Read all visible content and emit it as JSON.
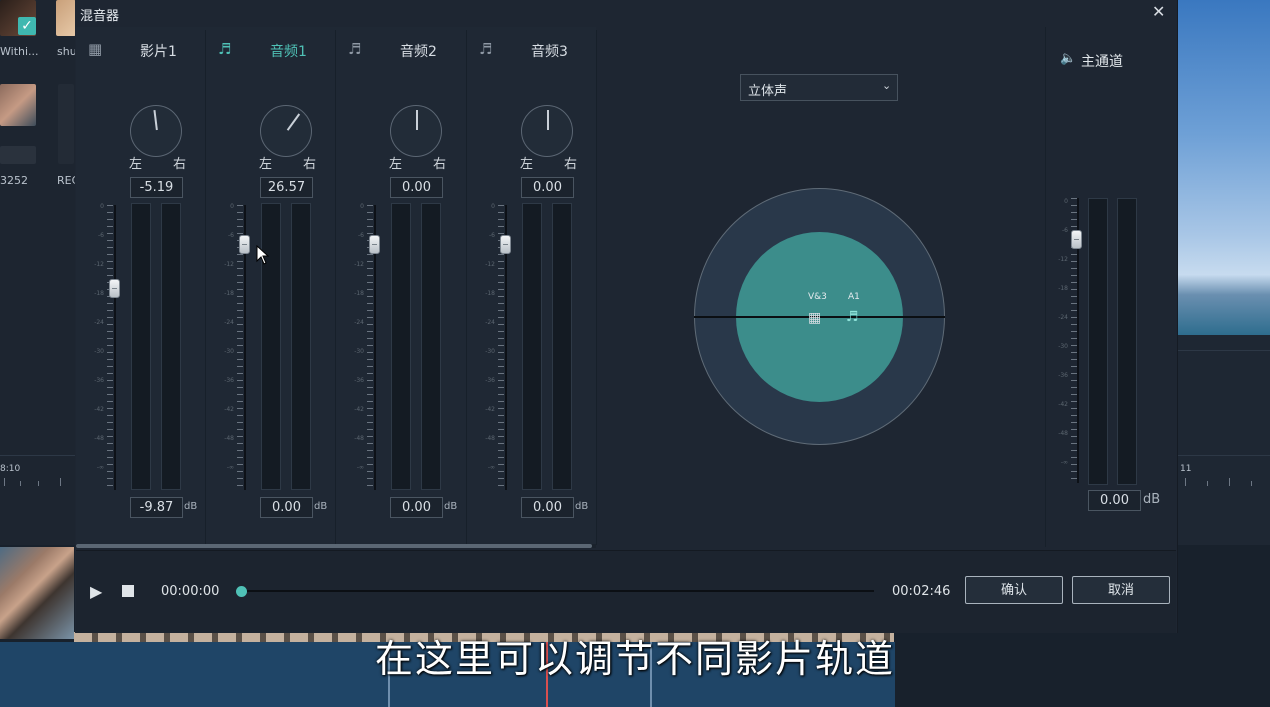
{
  "background": {
    "thumb_labels": [
      "Withi...",
      "shu",
      "3252",
      "REC"
    ],
    "ruler_left": "8:10",
    "ruler_right": "11",
    "subtitle": "在这里可以调节不同影片轨道"
  },
  "dialog": {
    "title": "混音器",
    "close_glyph": "✕"
  },
  "channels": [
    {
      "icon": "▦",
      "name": "影片1",
      "active": false,
      "pan_left": "左",
      "pan_right": "右",
      "pan_value": "-5.19",
      "volume": "-9.87",
      "unit": "dB",
      "fader_level_db": -9.87
    },
    {
      "icon": "♬",
      "name": "音频1",
      "active": true,
      "pan_left": "左",
      "pan_right": "右",
      "pan_value": "26.57",
      "volume": "0.00",
      "unit": "dB",
      "fader_level_db": 0
    },
    {
      "icon": "♬",
      "name": "音频2",
      "active": false,
      "pan_left": "左",
      "pan_right": "右",
      "pan_value": "0.00",
      "volume": "0.00",
      "unit": "dB",
      "fader_level_db": 0
    },
    {
      "icon": "♬",
      "name": "音频3",
      "active": false,
      "pan_left": "左",
      "pan_right": "右",
      "pan_value": "0.00",
      "volume": "0.00",
      "unit": "dB",
      "fader_level_db": 0
    }
  ],
  "scale_labels": [
    "0",
    "-6",
    "-12",
    "-18",
    "-24",
    "-30",
    "-36",
    "-42",
    "-48",
    "-∞"
  ],
  "pan_panel": {
    "mode": "立体声",
    "chevron": "⌄",
    "label_video": "V&3",
    "label_audio": "A1",
    "icon_video": "▦",
    "icon_audio": "♬",
    "inner_color": "#3c8d8b"
  },
  "master": {
    "icon": "🔈",
    "name": "主通道",
    "volume": "0.00",
    "unit": "dB",
    "fader_level_db": 0
  },
  "transport": {
    "play_glyph": "▶",
    "time_start": "00:00:00",
    "time_end": "00:02:46",
    "ok_label": "确认",
    "cancel_label": "取消"
  },
  "colors": {
    "accent": "#4fc1b6",
    "dialog_bg": "#1e2632"
  }
}
